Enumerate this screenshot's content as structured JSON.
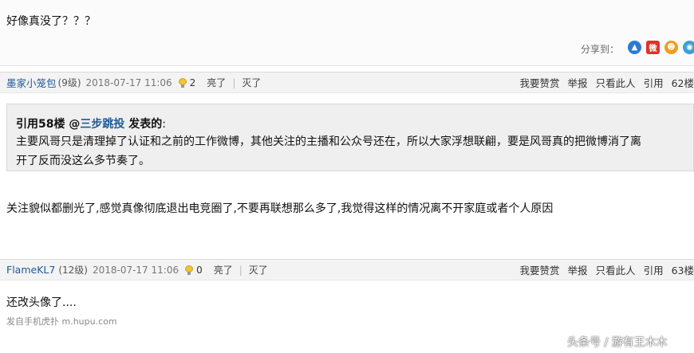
{
  "post": {
    "text": "好像真没了？？？",
    "share_label": "分享到：",
    "share_icons": [
      {
        "name": "qzone-icon",
        "color": "#2b7bd1",
        "glyph": "▲"
      },
      {
        "name": "weibo-icon",
        "color": "#e0322b",
        "glyph": "微"
      },
      {
        "name": "tencent-icon",
        "color": "#f29c1f",
        "glyph": "☻"
      },
      {
        "name": "renren-icon",
        "color": "#3aa0d8",
        "glyph": "◉"
      }
    ]
  },
  "replies": [
    {
      "user": "墨家小笼包",
      "level": "(9级)",
      "time": "2018-07-17 11:06",
      "likes": "2",
      "light": "亮了",
      "sep": "|",
      "dim": "灭了",
      "actions": [
        "我要赞赏",
        "举报",
        "只看此人",
        "引用",
        "62楼"
      ],
      "quote": {
        "prefix": "引用58楼 @",
        "user": "三步跳投",
        "suffix": " 发表的",
        "colon": ":",
        "line1": "主要风哥只是清理掉了认证和之前的工作微博，其他关注的主播和公众号还在，所以大家浮想联翩，要是风哥真的把微博消了离",
        "line2": "开了反而没这么多节奏了。"
      },
      "body": "关注貌似都删光了,感觉真像彻底退出电竞圈了,不要再联想那么多了,我觉得这样的情况离不开家庭或者个人原因"
    },
    {
      "user": "FlameKL7",
      "level": "(12级)",
      "time": "2018-07-17 11:06",
      "likes": "0",
      "light": "亮了",
      "sep": "|",
      "dim": "灭了",
      "actions": [
        "我要赞赏",
        "举报",
        "只看此人",
        "引用",
        "63楼"
      ],
      "body": "还改头像了....",
      "source": "发自手机虎扑 m.hupu.com"
    }
  ],
  "watermark": "头条号 / 游有王木木"
}
